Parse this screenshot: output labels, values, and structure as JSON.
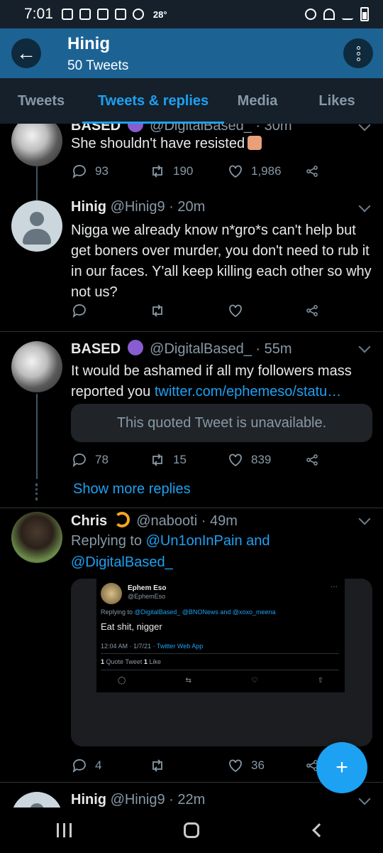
{
  "status_bar": {
    "time": "7:01",
    "temperature": "28°"
  },
  "app_bar": {
    "title": "Hinig",
    "subtitle": "50 Tweets"
  },
  "tabs": [
    {
      "label": "Tweets",
      "active": false
    },
    {
      "label": "Tweets & replies",
      "active": true
    },
    {
      "label": "Media",
      "active": false
    },
    {
      "label": "Likes",
      "active": false
    }
  ],
  "tweets": [
    {
      "name": "BASED",
      "handle": "@DigitalBased_",
      "time": "· 30m",
      "text": "She shouldn't have resisted",
      "replies": "93",
      "retweets": "190",
      "likes": "1,986"
    },
    {
      "name": "Hinig",
      "handle": "@Hinig9",
      "time": "· 20m",
      "text": "Nigga we already know n*gro*s can't help but get boners over murder, you don't need to rub it in our faces. Y'all keep killing each other so why not us?",
      "replies": "",
      "retweets": "",
      "likes": ""
    },
    {
      "name": "BASED",
      "handle": "@DigitalBased_",
      "time": "· 55m",
      "text": "It would be ashamed if all my followers mass reported you",
      "link": "twitter.com/ephemeso/statu…",
      "quoted": "This quoted Tweet is unavailable.",
      "replies": "78",
      "retweets": "15",
      "likes": "839"
    },
    {
      "name": "Chris",
      "handle": "@nabooti",
      "time": "· 49m",
      "reply_prefix": "Replying to",
      "reply_users": "@Un1onInPain and @DigitalBased_",
      "replies": "4",
      "retweets": "",
      "likes": "36"
    },
    {
      "name": "Hinig",
      "handle": "@Hinig9",
      "time": "· 22m"
    }
  ],
  "show_more": "Show more replies",
  "embedded_screenshot": {
    "name": "Ephem Eso",
    "handle": "@EphemEso",
    "reply_prefix": "Replying to",
    "reply_users": "@DigitalBased_ @BNONews and @xoxo_meena",
    "text": "Eat shit, nigger",
    "time": "12:04 AM · 1/7/21 ·",
    "app": "Twitter Web App",
    "quote_count": "1",
    "quote_label": "Quote Tweet",
    "like_count": "1",
    "like_label": "Like"
  },
  "fab": {
    "label": "+"
  }
}
